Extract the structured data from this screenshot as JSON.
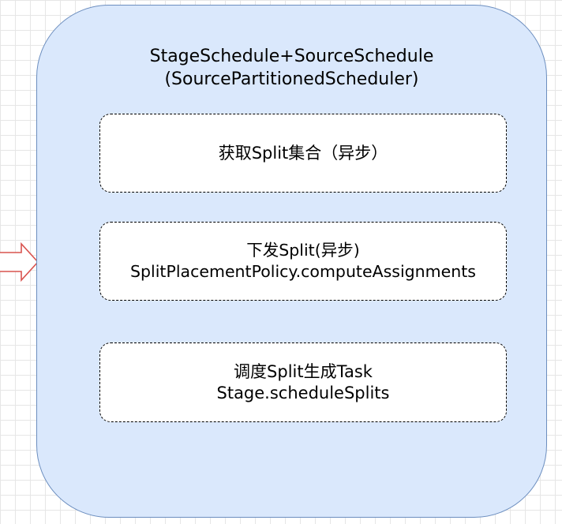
{
  "diagram": {
    "container": {
      "title_line1": "StageSchedule+SourceSchedule",
      "title_line2": "(SourcePartitionedScheduler)"
    },
    "steps": [
      {
        "line1": "获取Split集合（异步）"
      },
      {
        "line1": "下发Split(异步)",
        "line2": "SplitPlacementPolicy.computeAssignments"
      },
      {
        "line1": "调度Split生成Task",
        "line2": "Stage.scheduleSplits"
      }
    ]
  },
  "colors": {
    "container_fill": "#dae8fc",
    "container_stroke": "#6c8ebf",
    "step_fill": "#ffffff",
    "arrow_stroke": "#d9534f"
  }
}
